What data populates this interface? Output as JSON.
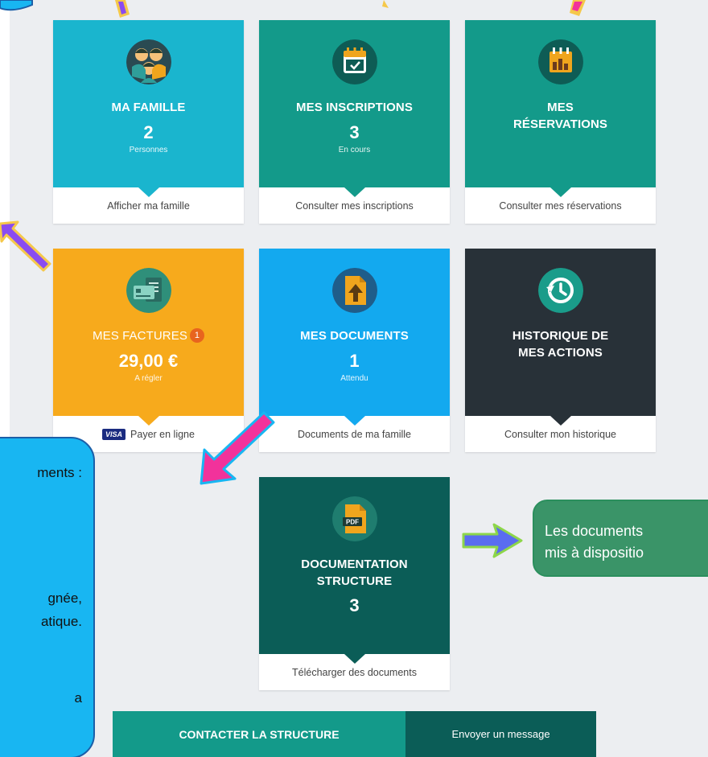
{
  "tiles": [
    {
      "title": "MA FAMILLE",
      "value": "2",
      "sub": "Personnes",
      "link": "Afficher ma famille",
      "color": "#1ab5ce"
    },
    {
      "title": "MES INSCRIPTIONS",
      "value": "3",
      "sub": "En cours",
      "link": "Consulter mes inscriptions",
      "color": "#139a8a"
    },
    {
      "title_line1": "MES",
      "title_line2": "RÉSERVATIONS",
      "link": "Consulter mes réservations",
      "color": "#139a8a"
    },
    {
      "title": "MES FACTURES",
      "badge": "1",
      "value": "29,00 €",
      "sub": "A régler",
      "link": "Payer en ligne",
      "card_label": "VISA",
      "color": "#f7aa1c"
    },
    {
      "title": "MES DOCUMENTS",
      "value": "1",
      "sub": "Attendu",
      "link": "Documents de ma famille",
      "color": "#13a9ef"
    },
    {
      "title_line1": "HISTORIQUE DE",
      "title_line2": "MES ACTIONS",
      "link": "Consulter mon historique",
      "color": "#283138"
    },
    {
      "title_line1": "DOCUMENTATION",
      "title_line2": "STRUCTURE",
      "value": "3",
      "link": "Télécharger des documents",
      "icon_label": "PDF",
      "color": "#0b5d57"
    }
  ],
  "contact": {
    "label": "CONTACTER LA STRUCTURE",
    "action": "Envoyer un message"
  },
  "annotations": {
    "left_bubble": [
      "ments :",
      "gnée,",
      "atique.",
      "a"
    ],
    "right_bubble": [
      "Les documents",
      "mis à dispositio"
    ]
  },
  "icons": [
    "family-icon",
    "calendar-check-icon",
    "calendar-chart-icon",
    "invoice-card-icon",
    "document-upload-icon",
    "history-clock-icon",
    "pdf-file-icon"
  ],
  "accent_colors": {
    "arrow_pink": "#f2329b",
    "arrow_purple": "#8a4cf0",
    "arrow_outline": "#f5c84a"
  }
}
